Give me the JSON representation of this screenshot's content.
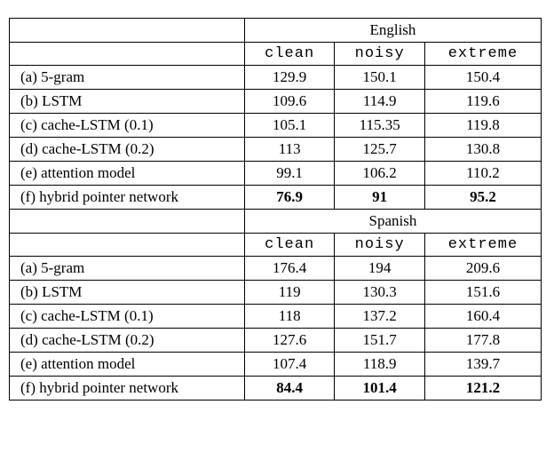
{
  "chart_data": [
    {
      "type": "table",
      "title": "English",
      "columns": [
        "clean",
        "noisy",
        "extreme"
      ],
      "rows": [
        {
          "label": "(a) 5-gram",
          "values": [
            129.9,
            150.1,
            150.4
          ],
          "bold": false
        },
        {
          "label": "(b) LSTM",
          "values": [
            109.6,
            114.9,
            119.6
          ],
          "bold": false
        },
        {
          "label": "(c) cache-LSTM (0.1)",
          "values": [
            105.1,
            115.35,
            119.8
          ],
          "bold": false
        },
        {
          "label": "(d) cache-LSTM (0.2)",
          "values": [
            113.0,
            125.7,
            130.8
          ],
          "bold": false
        },
        {
          "label": "(e) attention model",
          "values": [
            99.1,
            106.2,
            110.2
          ],
          "bold": false
        },
        {
          "label": "(f) hybrid pointer network",
          "values": [
            76.9,
            91.0,
            95.2
          ],
          "bold": true
        }
      ]
    },
    {
      "type": "table",
      "title": "Spanish",
      "columns": [
        "clean",
        "noisy",
        "extreme"
      ],
      "rows": [
        {
          "label": "(a) 5-gram",
          "values": [
            176.4,
            194.0,
            209.6
          ],
          "bold": false
        },
        {
          "label": "(b) LSTM",
          "values": [
            119.0,
            130.3,
            151.6
          ],
          "bold": false
        },
        {
          "label": "(c) cache-LSTM (0.1)",
          "values": [
            118.0,
            137.2,
            160.4
          ],
          "bold": false
        },
        {
          "label": "(d) cache-LSTM (0.2)",
          "values": [
            127.6,
            151.7,
            177.8
          ],
          "bold": false
        },
        {
          "label": "(e) attention model",
          "values": [
            107.4,
            118.9,
            139.7
          ],
          "bold": false
        },
        {
          "label": "(f) hybrid pointer network",
          "values": [
            84.4,
            101.4,
            121.2
          ],
          "bold": true
        }
      ]
    }
  ]
}
